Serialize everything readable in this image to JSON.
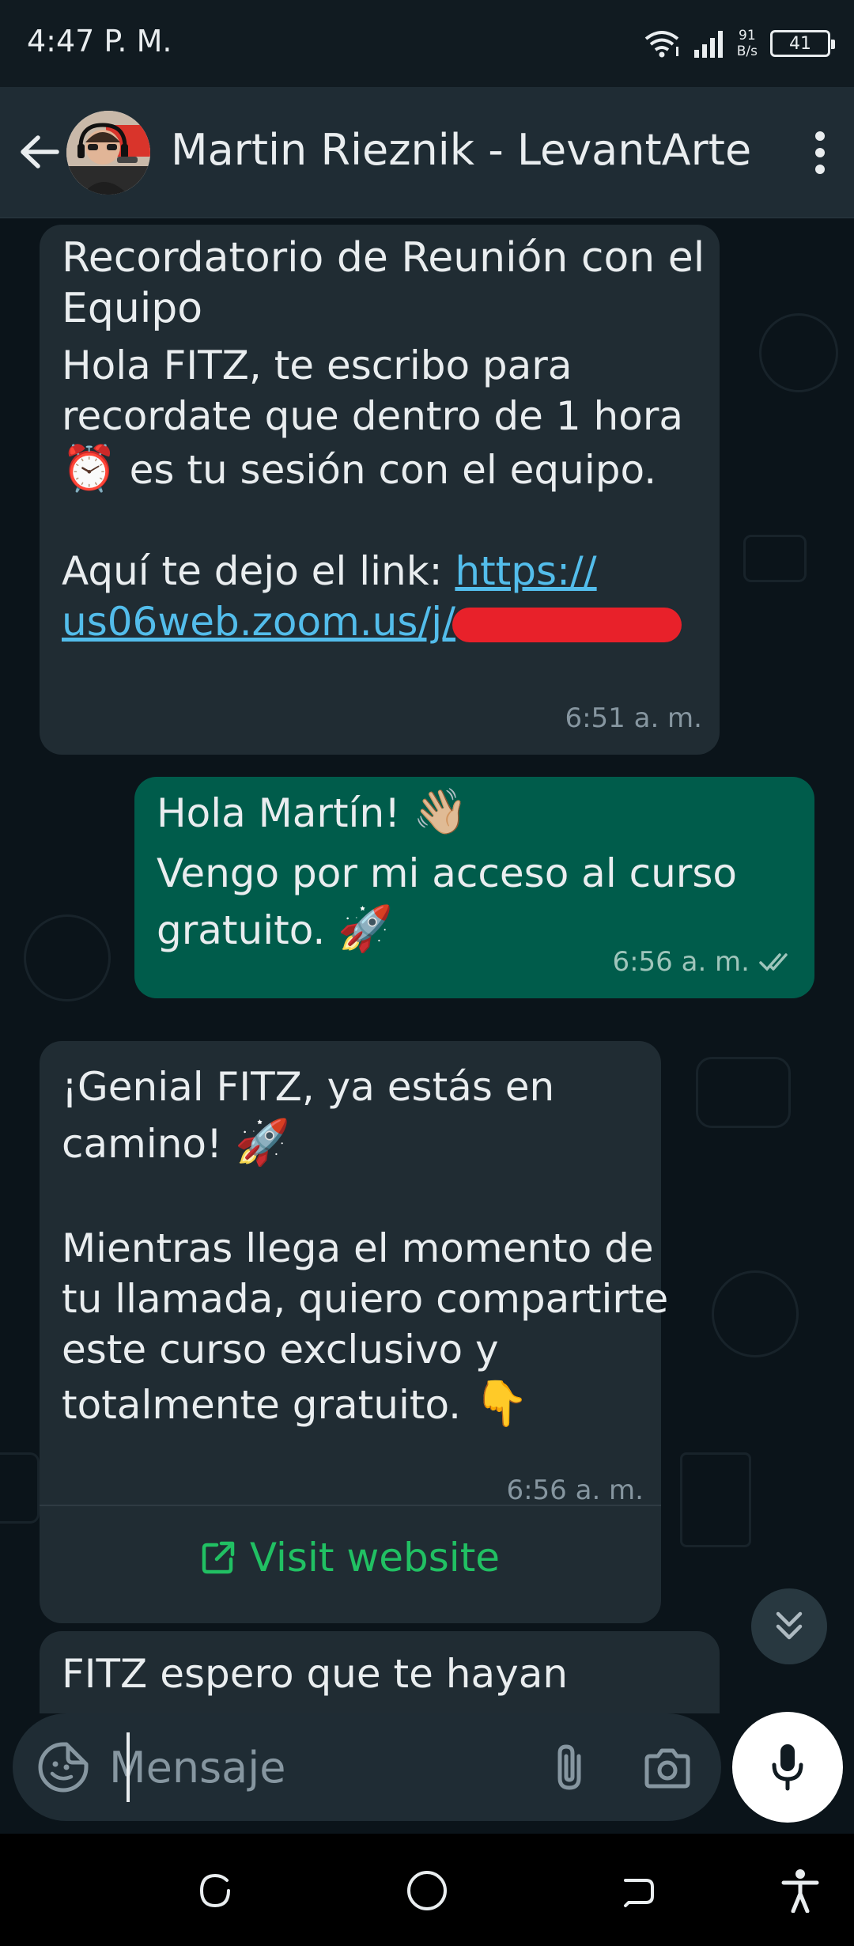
{
  "status_bar": {
    "time": "4:47 P. M.",
    "net_speed_value": "91",
    "net_speed_unit": "B/s",
    "battery": "41"
  },
  "header": {
    "contact_name": "Martin Rieznik - LevantArte"
  },
  "messages": [
    {
      "direction": "incoming",
      "title": "Recordatorio de Reunión con el Equipo",
      "title_lines": [
        "Recordatorio de Reunión con el",
        "Equipo"
      ],
      "lines": [
        "Hola FITZ, te escribo para",
        "recordate que dentro de 1 hora",
        "es tu sesión con el equipo."
      ],
      "link_prefix": "Aquí te dejo el link: ",
      "link_part1": "https://",
      "link_part2": "us06web.zoom.us/j/",
      "time": "6:51 a. m."
    },
    {
      "direction": "outgoing",
      "lines": [
        "Hola Martín!",
        "Vengo por mi acceso al curso",
        "gratuito."
      ],
      "time": "6:56 a. m."
    },
    {
      "direction": "incoming",
      "lines": [
        "¡Genial FITZ, ya estás en",
        "camino!",
        "Mientras llega el momento de",
        "tu llamada, quiero compartirte",
        "este curso exclusivo y",
        "totalmente gratuito."
      ],
      "time": "6:56 a. m.",
      "action": "Visit website"
    },
    {
      "direction": "incoming",
      "lines": [
        "FITZ espero que te hayan"
      ]
    }
  ],
  "input": {
    "placeholder": "Mensaje"
  },
  "colors": {
    "background": "#0b141a",
    "header": "#1f2c34",
    "incoming_bubble": "#202c33",
    "outgoing_bubble": "#005c4b",
    "link": "#53bdeb",
    "action": "#21c063",
    "redaction": "#e8212a"
  },
  "icons": [
    "back-arrow-icon",
    "more-vert-icon",
    "alarm-clock-emoji",
    "waving-hand-emoji",
    "rocket-emoji",
    "pointing-down-emoji",
    "external-link-icon",
    "double-chevron-down-icon",
    "sticker-icon",
    "paperclip-icon",
    "camera-icon",
    "microphone-icon",
    "double-check-icon"
  ]
}
